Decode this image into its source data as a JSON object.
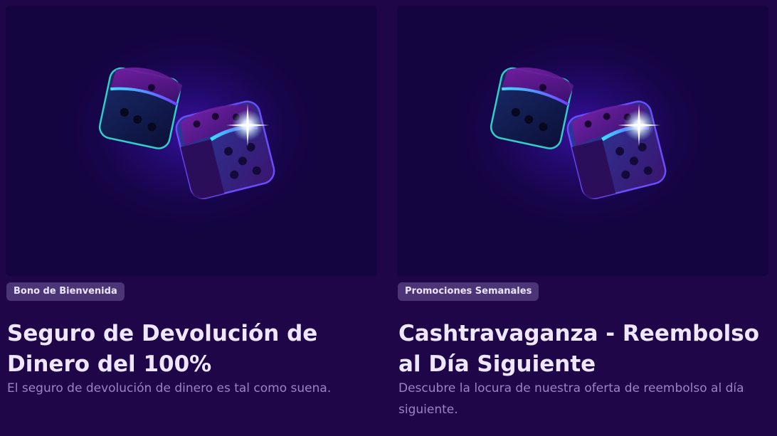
{
  "cards": [
    {
      "badge": "Bono de Bienvenida",
      "title": "Seguro de Devolución de Dinero del 100%",
      "description": "El seguro de devolución de dinero es tal como suena.",
      "image_icon": "dice-icon"
    },
    {
      "badge": "Promociones Semanales",
      "title": "Cashtravaganza - Reembolso al Día Siguiente",
      "description": "Descubre la locura de nuestra oferta de reembolso al día siguiente.",
      "image_icon": "dice-icon"
    }
  ],
  "colors": {
    "background": "#1e0648",
    "badge_bg": "#4b3577",
    "title": "#efe6ff",
    "description": "#9a85c4",
    "accent_cyan": "#3ee0ff",
    "accent_purple": "#8a2be2"
  }
}
